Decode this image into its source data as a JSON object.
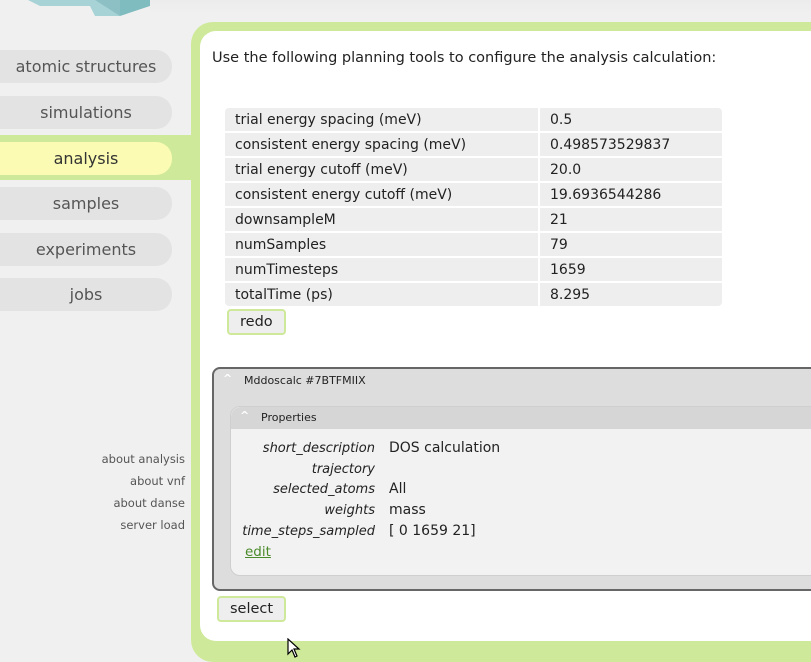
{
  "nav": {
    "items": [
      {
        "label": "atomic structures"
      },
      {
        "label": "simulations"
      },
      {
        "label": "analysis"
      },
      {
        "label": "samples"
      },
      {
        "label": "experiments"
      },
      {
        "label": "jobs"
      }
    ],
    "active": "analysis"
  },
  "side_links": [
    "about analysis",
    "about vnf",
    "about danse",
    "server load"
  ],
  "main": {
    "intro": "Use the following planning tools to configure the analysis calculation:",
    "params": [
      {
        "name": "trial energy spacing (meV)",
        "value": "0.5"
      },
      {
        "name": "consistent energy spacing (meV)",
        "value": "0.498573529837"
      },
      {
        "name": "trial energy cutoff (meV)",
        "value": "20.0"
      },
      {
        "name": "consistent energy cutoff (meV)",
        "value": "19.6936544286"
      },
      {
        "name": "downsampleM",
        "value": "21"
      },
      {
        "name": "numSamples",
        "value": "79"
      },
      {
        "name": "numTimesteps",
        "value": "1659"
      },
      {
        "name": "totalTime (ps)",
        "value": "8.295"
      }
    ],
    "redo_label": "redo",
    "panel": {
      "title": "Mddoscalc #7BTFMIIX",
      "properties_title": "Properties",
      "properties": [
        {
          "key": "short_description",
          "value": "DOS calculation"
        },
        {
          "key": "trajectory",
          "value": ""
        },
        {
          "key": "selected_atoms",
          "value": "All"
        },
        {
          "key": "weights",
          "value": "mass"
        },
        {
          "key": "time_steps_sampled",
          "value": "[ 0 1659 21]"
        }
      ],
      "edit_label": "edit",
      "collapse_glyph": "^"
    },
    "select_label": "select"
  },
  "colors": {
    "accent_green": "#cfe99a",
    "active_nav": "#fbfbb3",
    "nav_inactive": "#e3e3e3",
    "link_green": "#4a8a2a"
  }
}
